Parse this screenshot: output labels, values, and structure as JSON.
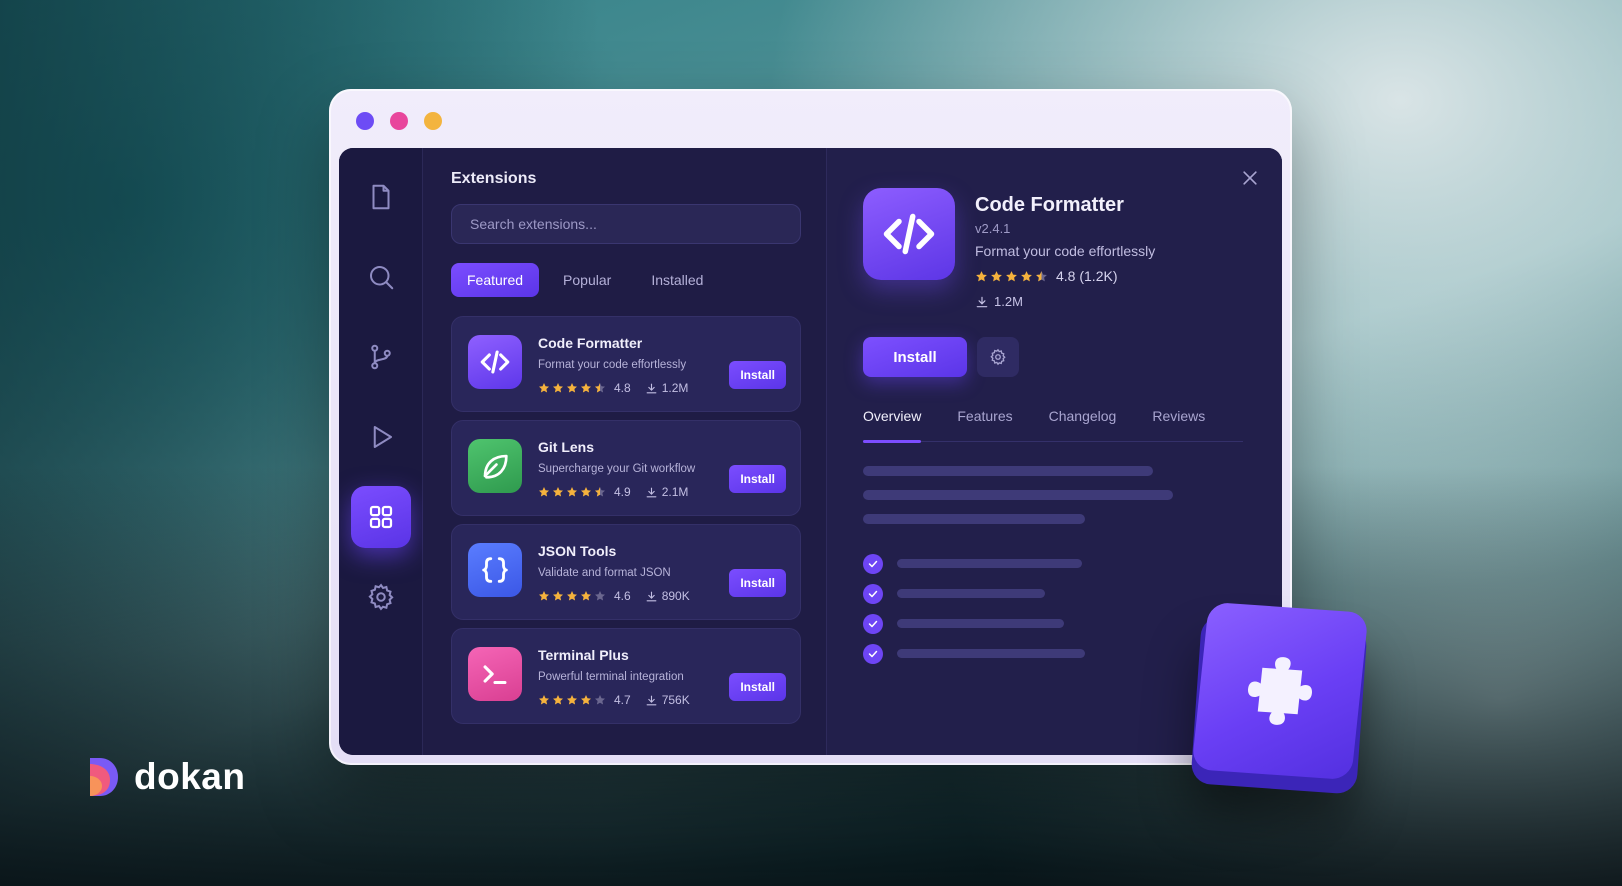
{
  "brand": {
    "name": "dokan"
  },
  "window": {
    "dot_colors": [
      "#6d4cf5",
      "#e8469c",
      "#f3b43f"
    ]
  },
  "sidebar": {
    "items": [
      {
        "icon": "file-icon"
      },
      {
        "icon": "search-icon"
      },
      {
        "icon": "git-branch-icon"
      },
      {
        "icon": "play-icon"
      },
      {
        "icon": "extensions-grid-icon",
        "active": true
      },
      {
        "icon": "gear-icon"
      }
    ]
  },
  "extensions": {
    "title": "Extensions",
    "search_placeholder": "Search extensions...",
    "tabs": [
      {
        "label": "Featured",
        "active": true
      },
      {
        "label": "Popular"
      },
      {
        "label": "Installed"
      }
    ],
    "install_label": "Install",
    "items": [
      {
        "name": "Code Formatter",
        "description": "Format your code effortlessly",
        "rating": "4.8",
        "downloads": "1.2M",
        "icon": "code-brackets-icon",
        "color": "#7a4dff"
      },
      {
        "name": "Git Lens",
        "description": "Supercharge your Git workflow",
        "rating": "4.9",
        "downloads": "2.1M",
        "icon": "leaf-icon",
        "color": "#3fb45f"
      },
      {
        "name": "JSON Tools",
        "description": "Validate and format JSON",
        "rating": "4.6",
        "downloads": "890K",
        "icon": "curly-braces-icon",
        "color": "#4a6cf7"
      },
      {
        "name": "Terminal Plus",
        "description": "Powerful terminal integration",
        "rating": "4.7",
        "downloads": "756K",
        "icon": "terminal-icon",
        "color": "#ec4fa6"
      }
    ]
  },
  "detail": {
    "name": "Code Formatter",
    "version": "v2.4.1",
    "tagline": "Format your code effortlessly",
    "rating": "4.8 (1.2K)",
    "downloads": "1.2M",
    "install_label": "Install",
    "tabs": [
      {
        "label": "Overview",
        "active": true
      },
      {
        "label": "Features"
      },
      {
        "label": "Changelog"
      },
      {
        "label": "Reviews"
      }
    ]
  },
  "colors": {
    "accent": "#6f45f8",
    "star": "#f5b23d"
  }
}
